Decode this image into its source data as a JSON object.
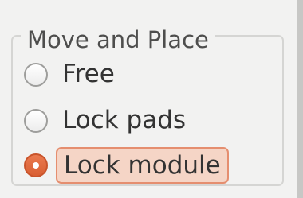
{
  "group": {
    "title": "Move and Place",
    "options": [
      {
        "label": "Free",
        "selected": false
      },
      {
        "label": "Lock pads",
        "selected": false
      },
      {
        "label": "Lock module",
        "selected": true,
        "focused": true
      }
    ]
  },
  "colors": {
    "accent": "#d95f33",
    "focus_fill": "#f5d5c6",
    "focus_border": "#e58e6f",
    "text": "#333333",
    "group_title": "#4e4e4d"
  }
}
